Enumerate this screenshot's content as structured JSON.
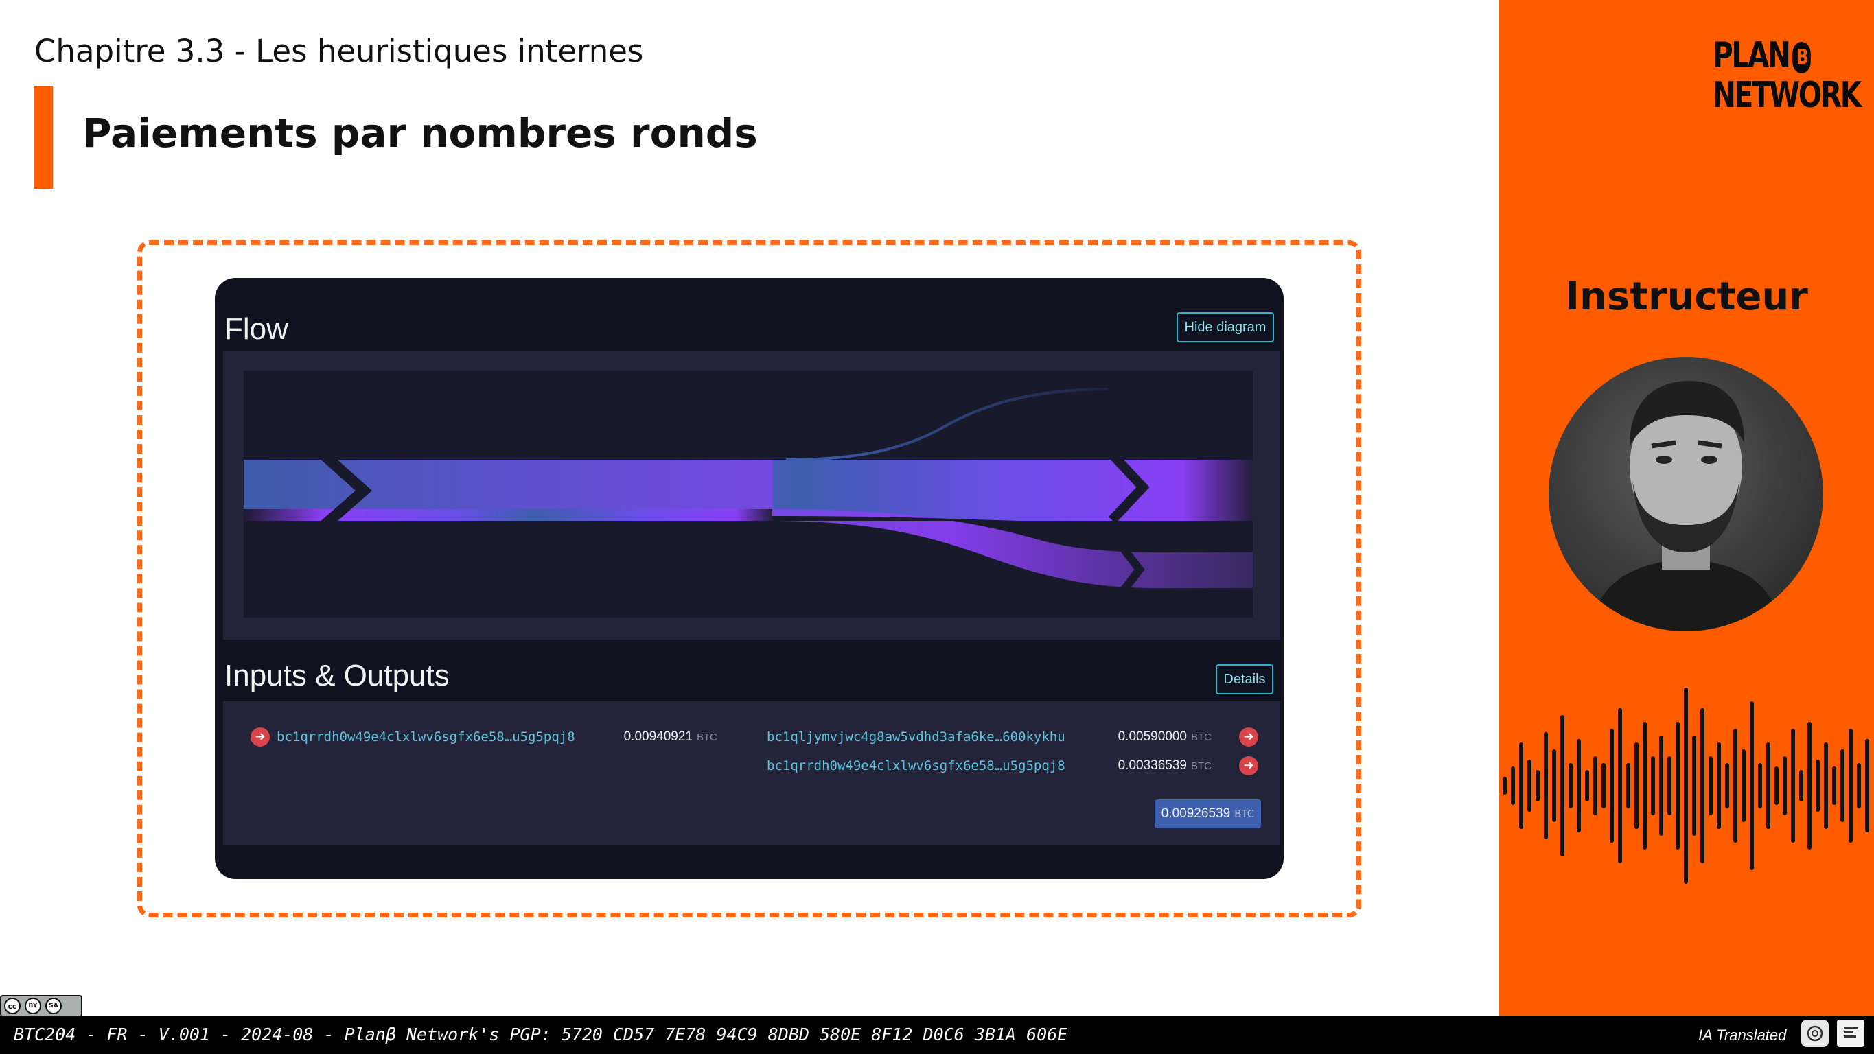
{
  "header": {
    "chapter": "Chapitre 3.3 - Les heuristiques internes",
    "title": "Paiements par nombres ronds"
  },
  "mempool": {
    "flow_title": "Flow",
    "hide_diagram_label": "Hide diagram",
    "io_title": "Inputs & Outputs",
    "details_label": "Details",
    "inputs": [
      {
        "address": "bc1qrrdh0w49e4clxlwv6sgfx6e58…u5g5pqj8",
        "amount": "0.00940921",
        "unit": "BTC"
      }
    ],
    "outputs": [
      {
        "address": "bc1qljymvjwc4g8aw5vdhd3afa6ke…600kykhu",
        "amount": "0.00590000",
        "unit": "BTC"
      },
      {
        "address": "bc1qrrdh0w49e4clxlwv6sgfx6e58…u5g5pqj8",
        "amount": "0.00336539",
        "unit": "BTC"
      }
    ],
    "total": {
      "amount": "0.00926539",
      "unit": "BTC"
    }
  },
  "sidebar": {
    "logo_line1": "PLAN",
    "logo_b": "B",
    "logo_line2": "NETWORK",
    "instructor_label": "Instructeur"
  },
  "footer": {
    "text": "BTC204 - FR - V.001 - 2024-08 - Planβ Network's PGP: 5720 CD57 7E78 94C9 8DBD 580E 8F12 D0C6 3B1A 606E",
    "ia_label": "IA Translated",
    "license": {
      "cc": "cc",
      "by": "BY",
      "sa": "SA"
    }
  },
  "colors": {
    "accent": "#ff5c00",
    "mempool_bg": "#11121f",
    "mempool_panel": "#23243a",
    "flow_purple": "#8a3ff5",
    "flow_blue": "#3d5fae",
    "address_blue": "#5ec3dc",
    "total_blue": "#3d5fae"
  }
}
